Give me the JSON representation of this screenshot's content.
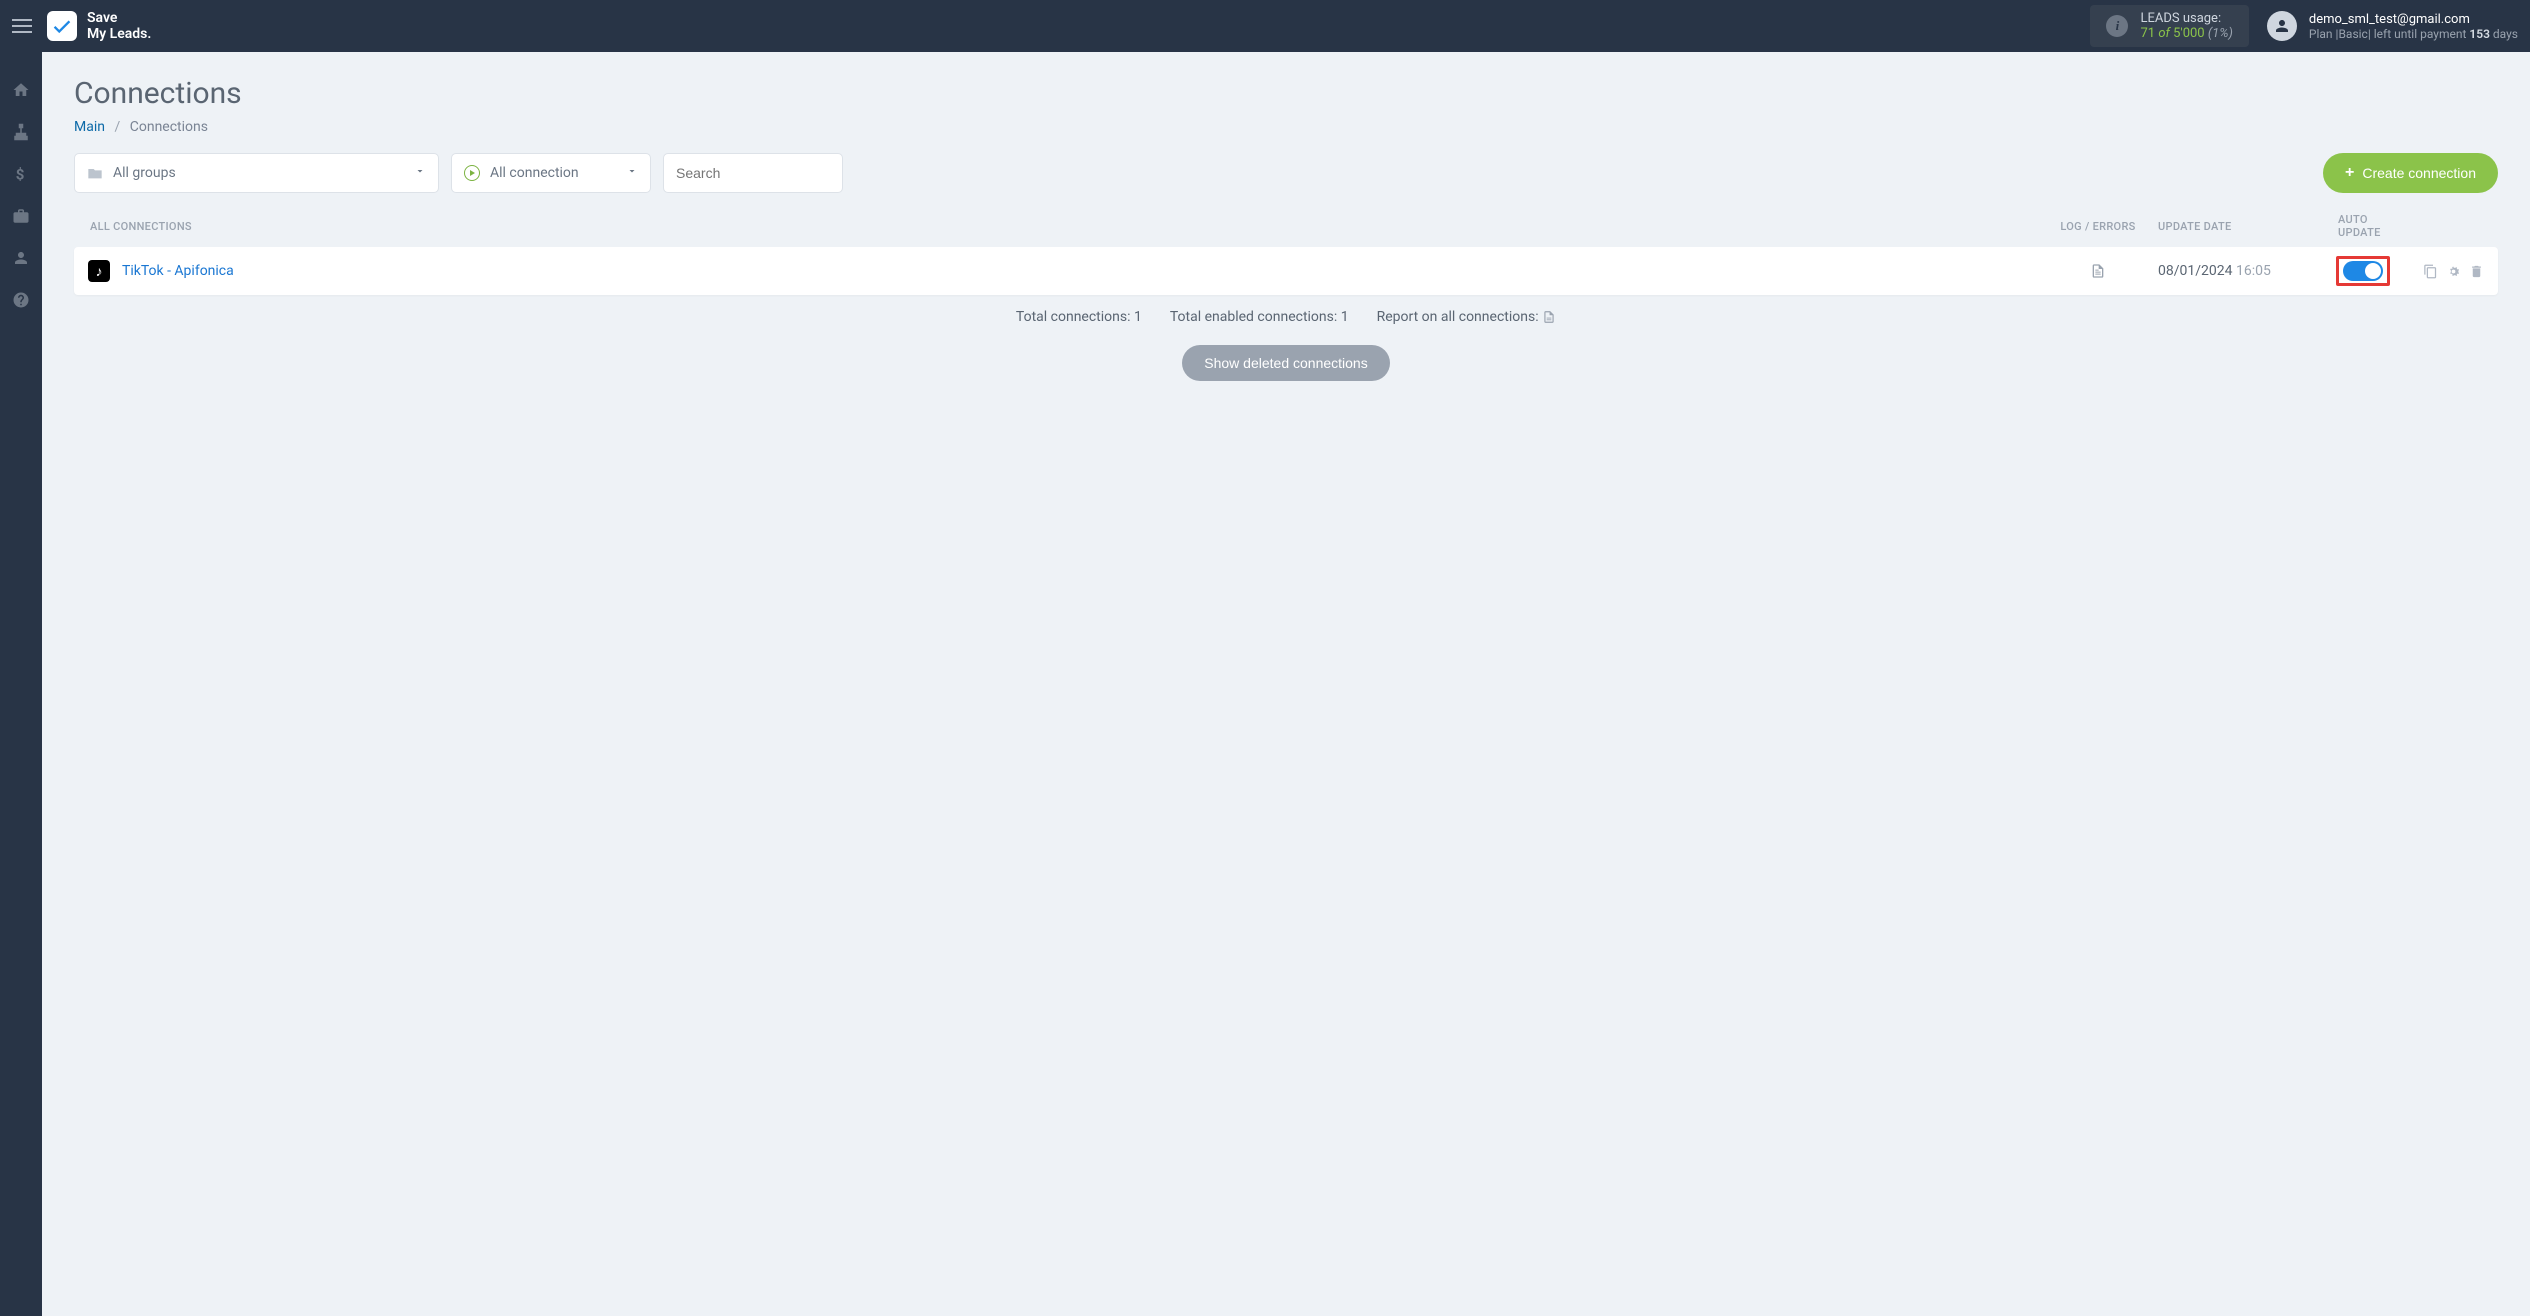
{
  "brand": {
    "line1": "Save",
    "line2": "My Leads."
  },
  "usage": {
    "label": "LEADS usage:",
    "current": "71",
    "of_word": "of",
    "max": "5'000",
    "percent": "(1%)"
  },
  "account": {
    "email": "demo_sml_test@gmail.com",
    "plan_prefix": "Plan |",
    "plan_name": "Basic",
    "plan_mid": "| left until payment ",
    "days": "153",
    "days_word": " days"
  },
  "sidebar": {
    "items": [
      "home-icon",
      "sitemap-icon",
      "dollar-icon",
      "briefcase-icon",
      "user-icon",
      "help-icon"
    ]
  },
  "page": {
    "title": "Connections",
    "breadcrumb_main": "Main",
    "breadcrumb_sep": "/",
    "breadcrumb_current": "Connections"
  },
  "filters": {
    "groups_label": "All groups",
    "status_label": "All connection",
    "search_placeholder": "Search",
    "create_label": "Create connection"
  },
  "headers": {
    "name": "ALL CONNECTIONS",
    "log": "LOG / ERRORS",
    "date": "UPDATE DATE",
    "auto": "AUTO UPDATE"
  },
  "rows": [
    {
      "name": "TikTok - Apifonica",
      "date": "08/01/2024",
      "time": "16:05",
      "auto_on": true
    }
  ],
  "summary": {
    "total_label": "Total connections: ",
    "total_value": "1",
    "enabled_label": "Total enabled connections: ",
    "enabled_value": "1",
    "report_label": "Report on all connections: "
  },
  "show_deleted": "Show deleted connections"
}
